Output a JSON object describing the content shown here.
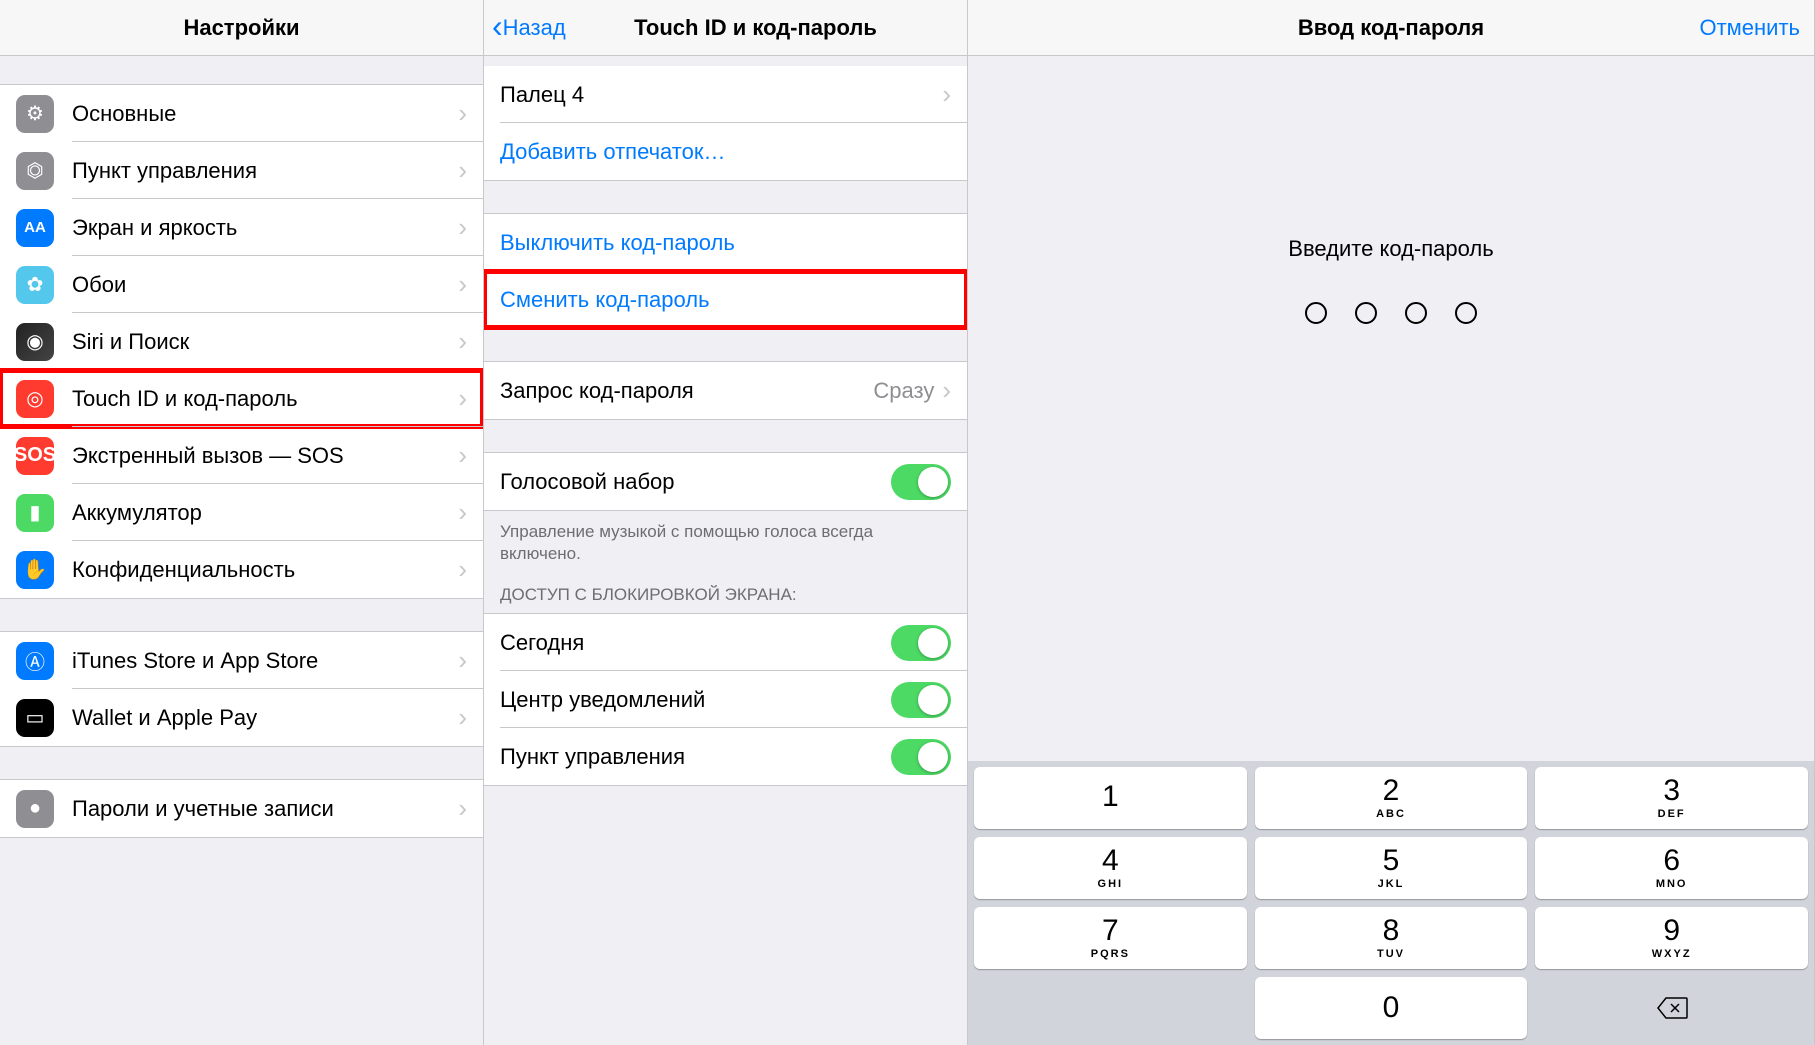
{
  "pane1": {
    "title": "Настройки",
    "group1": [
      {
        "key": "general",
        "label": "Основные",
        "icon": "gear"
      },
      {
        "key": "control",
        "label": "Пункт управления",
        "icon": "switches"
      },
      {
        "key": "display",
        "label": "Экран и яркость",
        "icon": "AA"
      },
      {
        "key": "wallpaper",
        "label": "Обои",
        "icon": "flower"
      },
      {
        "key": "siri",
        "label": "Siri и Поиск",
        "icon": "siri"
      },
      {
        "key": "touchid",
        "label": "Touch ID и код-пароль",
        "icon": "fingerprint",
        "highlight": true
      },
      {
        "key": "sos",
        "label": "Экстренный вызов — SOS",
        "icon": "SOS"
      },
      {
        "key": "battery",
        "label": "Аккумулятор",
        "icon": "battery"
      },
      {
        "key": "privacy",
        "label": "Конфиденциальность",
        "icon": "hand"
      }
    ],
    "group2": [
      {
        "key": "itunes",
        "label": "iTunes Store и App Store",
        "icon": "appstore"
      },
      {
        "key": "wallet",
        "label": "Wallet и Apple Pay",
        "icon": "wallet"
      }
    ],
    "group3": [
      {
        "key": "accounts",
        "label": "Пароли и учетные записи",
        "icon": "key"
      }
    ]
  },
  "pane2": {
    "back": "Назад",
    "title": "Touch ID и код-пароль",
    "finger": "Палец 4",
    "add_finger": "Добавить отпечаток…",
    "turn_off": "Выключить код-пароль",
    "change": "Сменить код-пароль",
    "require_label": "Запрос код-пароля",
    "require_value": "Сразу",
    "voice_dial": "Голосовой набор",
    "voice_footer": "Управление музыкой с помощью голоса всегда включено.",
    "access_header": "ДОСТУП С БЛОКИРОВКОЙ ЭКРАНА:",
    "today": "Сегодня",
    "notif": "Центр уведомлений",
    "control": "Пункт управления"
  },
  "pane3": {
    "title": "Ввод код-пароля",
    "cancel": "Отменить",
    "prompt": "Введите код-пароль",
    "keys": [
      {
        "n": "1",
        "l": ""
      },
      {
        "n": "2",
        "l": "ABC"
      },
      {
        "n": "3",
        "l": "DEF"
      },
      {
        "n": "4",
        "l": "GHI"
      },
      {
        "n": "5",
        "l": "JKL"
      },
      {
        "n": "6",
        "l": "MNO"
      },
      {
        "n": "7",
        "l": "PQRS"
      },
      {
        "n": "8",
        "l": "TUV"
      },
      {
        "n": "9",
        "l": "WXYZ"
      }
    ],
    "zero": "0"
  }
}
